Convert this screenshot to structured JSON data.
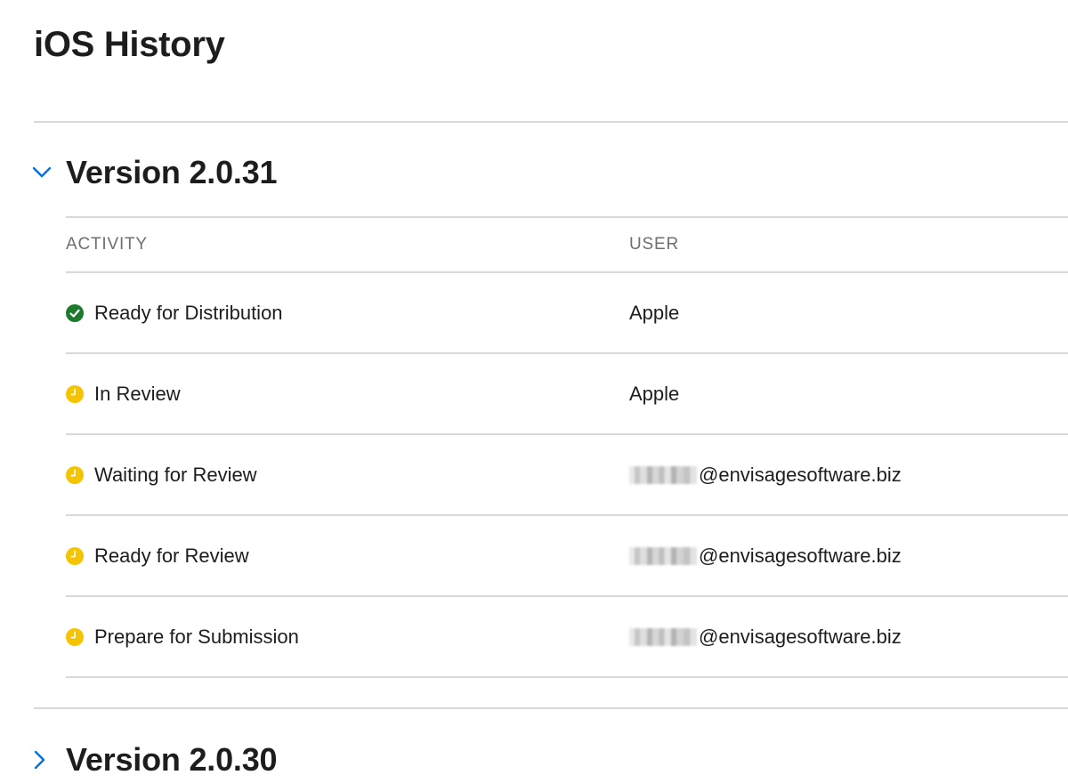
{
  "page": {
    "title": "iOS History"
  },
  "versions": [
    {
      "title": "Version 2.0.31",
      "expanded": true,
      "columns": {
        "activity": "ACTIVITY",
        "user": "USER"
      },
      "rows": [
        {
          "activity": "Ready for Distribution",
          "status": "complete",
          "status_icon": "check-circle-icon",
          "user": "Apple",
          "user_redacted": false
        },
        {
          "activity": "In Review",
          "status": "pending",
          "status_icon": "clock-icon",
          "user": "Apple",
          "user_redacted": false
        },
        {
          "activity": "Waiting for Review",
          "status": "pending",
          "status_icon": "clock-icon",
          "user": "@envisagesoftware.biz",
          "user_redacted": true
        },
        {
          "activity": "Ready for Review",
          "status": "pending",
          "status_icon": "clock-icon",
          "user": "@envisagesoftware.biz",
          "user_redacted": true
        },
        {
          "activity": "Prepare for Submission",
          "status": "pending",
          "status_icon": "clock-icon",
          "user": "@envisagesoftware.biz",
          "user_redacted": true
        }
      ]
    },
    {
      "title": "Version 2.0.30",
      "expanded": false
    }
  ],
  "colors": {
    "accent": "#0071e3",
    "complete": "#1d7a2c",
    "pending": "#f5c400",
    "divider": "#d8d8da",
    "muted_text": "#6e6e73"
  }
}
